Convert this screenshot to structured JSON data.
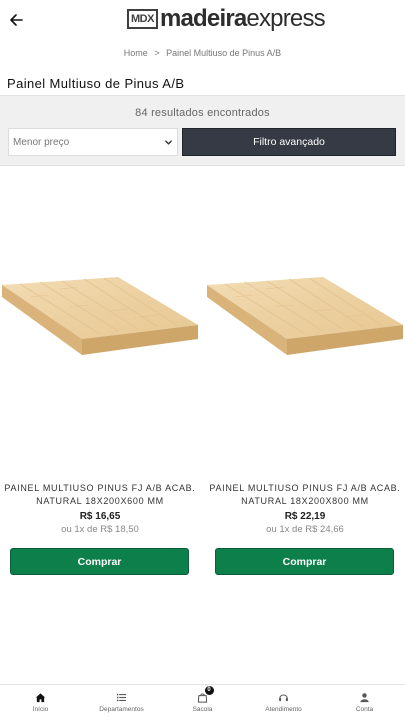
{
  "header": {
    "back_icon": "arrow-left-icon",
    "logo_badge": "MDX",
    "logo_word1": "madeira",
    "logo_word2": "express"
  },
  "breadcrumb": {
    "home": "Home",
    "separator": ">",
    "current": "Painel Multiuso de Pinus A/B"
  },
  "page_title": "Painel Multiuso de Pinus A/B",
  "filters": {
    "result_count": "84 resultados encontrados",
    "sort_selected": "Menor preço",
    "advanced_filter_label": "Filtro avançado"
  },
  "products": [
    {
      "name": "PAINEL MULTIUSO PINUS FJ A/B ACAB. NATURAL 18X200X600 MM",
      "price": "R$ 16,65",
      "installment": "ou 1x de R$ 18,50",
      "buy_label": "Comprar"
    },
    {
      "name": "PAINEL MULTIUSO PINUS FJ A/B ACAB. NATURAL 18X200X800 MM",
      "price": "R$ 22,19",
      "installment": "ou 1x de R$ 24,66",
      "buy_label": "Comprar"
    }
  ],
  "bottom_nav": {
    "items": [
      {
        "label": "Início",
        "icon": "home-icon"
      },
      {
        "label": "Departamentos",
        "icon": "list-icon"
      },
      {
        "label": "Sacola",
        "icon": "bag-icon",
        "badge": "0"
      },
      {
        "label": "Atendimento",
        "icon": "headset-icon"
      },
      {
        "label": "Conta",
        "icon": "user-icon"
      }
    ]
  },
  "colors": {
    "buy_button": "#0d7f4b",
    "filter_button": "#353a44",
    "filter_panel_bg": "#f0f0f0"
  }
}
